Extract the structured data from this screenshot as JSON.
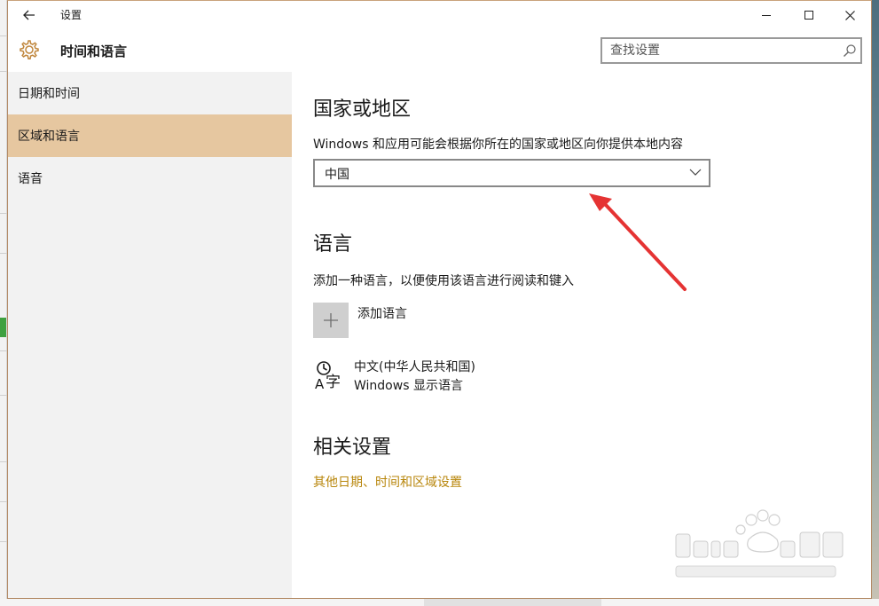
{
  "window": {
    "app_title": "设置",
    "back_icon": "back-arrow-icon",
    "controls": [
      "minimize-icon",
      "maximize-icon",
      "close-icon"
    ]
  },
  "header": {
    "icon": "gear-icon",
    "title": "时间和语言",
    "search_placeholder": "查找设置",
    "search_icon": "search-icon"
  },
  "sidebar": {
    "items": [
      {
        "label": "日期和时间",
        "active": false
      },
      {
        "label": "区域和语言",
        "active": true
      },
      {
        "label": "语音",
        "active": false
      }
    ]
  },
  "region": {
    "heading": "国家或地区",
    "description": "Windows 和应用可能会根据你所在的国家或地区向你提供本地内容",
    "selected": "中国",
    "chevron_icon": "chevron-down-icon"
  },
  "language": {
    "heading": "语言",
    "description": "添加一种语言，以便使用该语言进行阅读和键入",
    "add_label": "添加语言",
    "add_icon": "plus-icon",
    "installed": [
      {
        "name": "中文(中华人民共和国)",
        "sub": "Windows 显示语言",
        "icon": "language-icon"
      }
    ]
  },
  "related": {
    "heading": "相关设置",
    "link": "其他日期、时间和区域设置"
  },
  "colors": {
    "accent": "#e6c7a0",
    "link": "#b8860b",
    "sidebar_bg": "#f2f2f2",
    "annotation": "#e53333"
  }
}
